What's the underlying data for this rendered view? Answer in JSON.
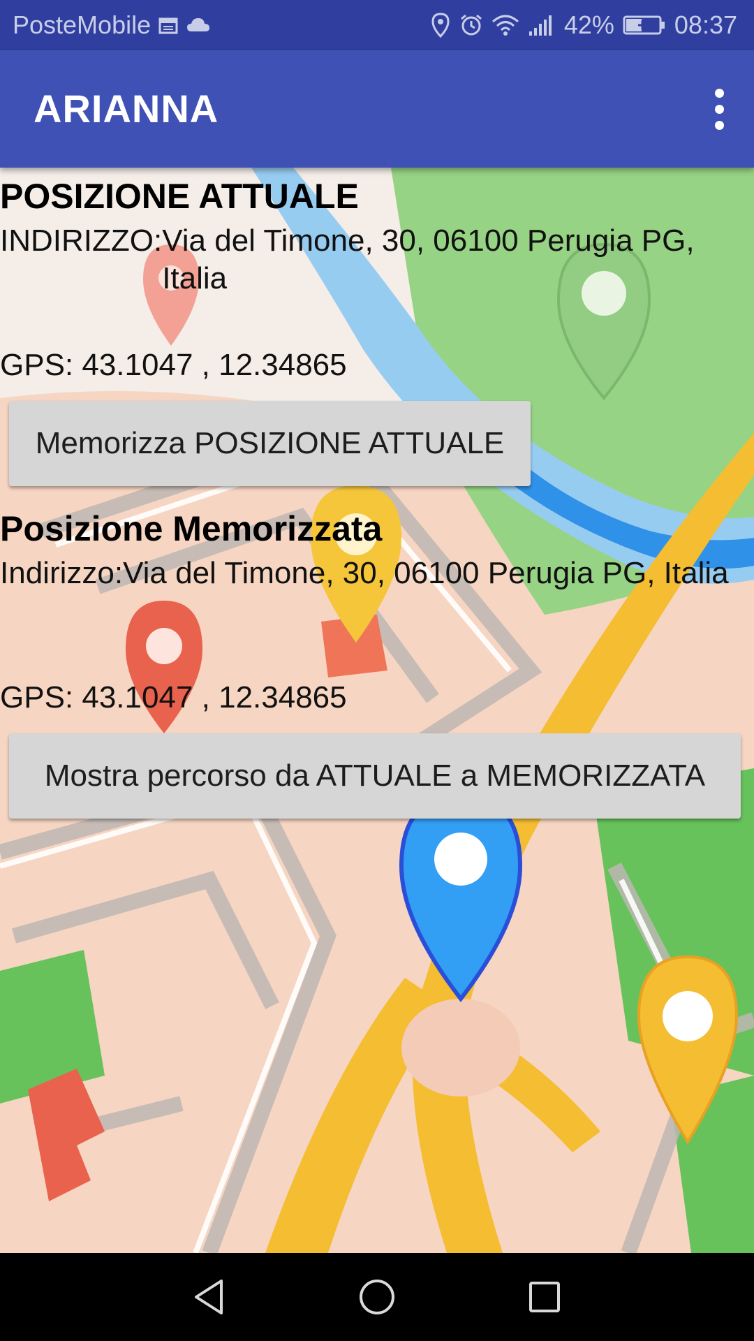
{
  "status_bar": {
    "carrier": "PosteMobile",
    "battery_percent": "42%",
    "time": "08:37",
    "icons": [
      "calendar-icon",
      "cloud-icon",
      "location-icon",
      "alarm-icon",
      "wifi-icon",
      "signal-icon",
      "battery-charging-icon"
    ]
  },
  "app_bar": {
    "title": "ARIANNA",
    "menu_icon": "more-vert-icon"
  },
  "current_position": {
    "heading": "POSIZIONE ATTUALE",
    "address_label": "INDIRIZZO:",
    "address_value": "Via del Timone, 30, 06100 Perugia PG, Italia",
    "gps_text": "GPS: 43.1047 , 12.34865",
    "save_button_label": "Memorizza POSIZIONE ATTUALE"
  },
  "saved_position": {
    "heading": "Posizione Memorizzata",
    "address_label": "Indirizzo:",
    "address_value": "Via del Timone, 30, 06100 Perugia PG, Italia",
    "gps_text": "GPS: 43.1047 , 12.34865",
    "route_button_label": "Mostra percorso da ATTUALE a MEMORIZZATA"
  },
  "nav_bar": {
    "icons": [
      "back-icon",
      "home-icon",
      "recents-icon"
    ]
  },
  "colors": {
    "status_bar": "#303f9f",
    "app_bar": "#3f51b5",
    "button": "#d6d6d6",
    "map_land": "#f6d2bd",
    "map_road": "#f5b820",
    "map_river": "#1e88e5",
    "map_park": "#4caf50"
  }
}
